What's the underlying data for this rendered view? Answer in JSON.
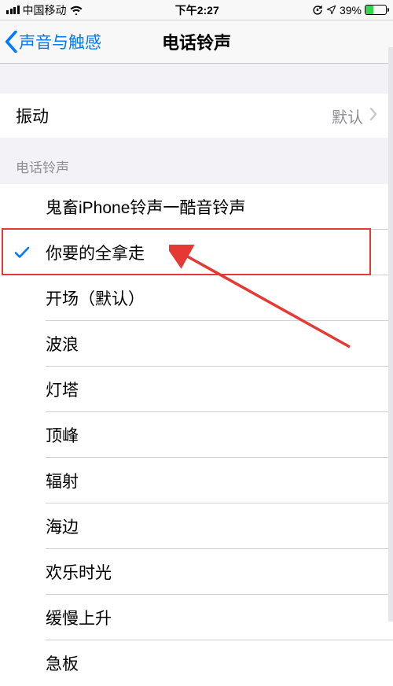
{
  "status": {
    "carrier": "中国移动",
    "time": "下午2:27",
    "battery_pct": "39%",
    "battery_fill_pct": 39
  },
  "nav": {
    "back_label": "声音与触感",
    "title": "电话铃声"
  },
  "vibration": {
    "label": "振动",
    "value": "默认"
  },
  "section_header": "电话铃声",
  "ringtones": [
    {
      "label": "鬼畜iPhone铃声一酷音铃声",
      "selected": false
    },
    {
      "label": "你要的全拿走",
      "selected": true
    },
    {
      "label": "开场（默认）",
      "selected": false
    },
    {
      "label": "波浪",
      "selected": false
    },
    {
      "label": "灯塔",
      "selected": false
    },
    {
      "label": "顶峰",
      "selected": false
    },
    {
      "label": "辐射",
      "selected": false
    },
    {
      "label": "海边",
      "selected": false
    },
    {
      "label": "欢乐时光",
      "selected": false
    },
    {
      "label": "缓慢上升",
      "selected": false
    },
    {
      "label": "急板",
      "selected": false
    }
  ],
  "annotations": {
    "highlight_index": 1
  }
}
